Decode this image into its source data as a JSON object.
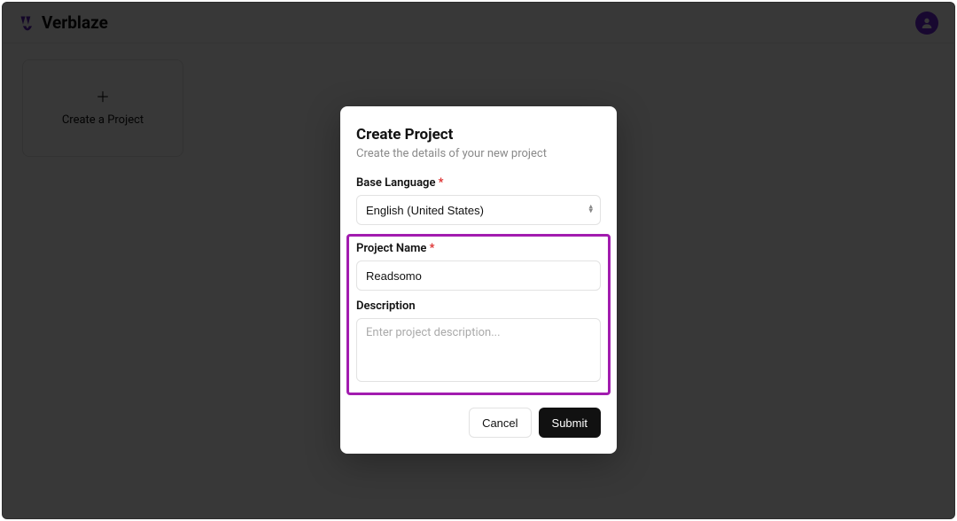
{
  "header": {
    "brand": "Verblaze"
  },
  "dashboard": {
    "create_card_label": "Create a Project"
  },
  "modal": {
    "title": "Create Project",
    "subtitle": "Create the details of your new project",
    "base_language_label": "Base Language ",
    "base_language_value": "English (United States)",
    "project_name_label": "Project Name ",
    "project_name_value": "Readsomo",
    "description_label": "Description",
    "description_placeholder": "Enter project description...",
    "description_value": "",
    "cancel_label": "Cancel",
    "submit_label": "Submit",
    "required_star": "*"
  }
}
